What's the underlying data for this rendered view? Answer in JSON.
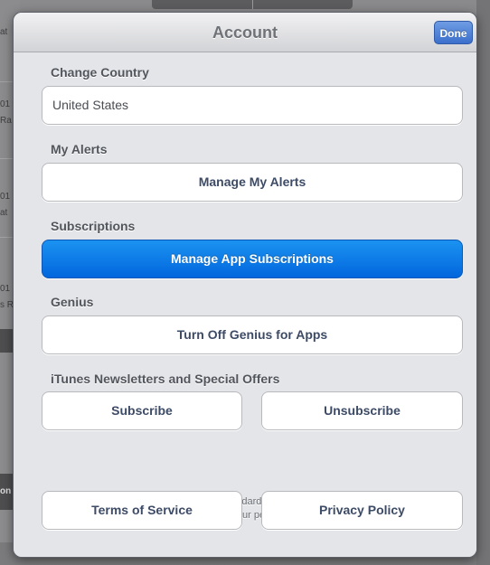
{
  "header": {
    "title": "Account",
    "done_label": "Done"
  },
  "country": {
    "section_label": "Change Country",
    "value": "United States"
  },
  "alerts": {
    "section_label": "My Alerts",
    "button_label": "Manage My Alerts"
  },
  "subscriptions": {
    "section_label": "Subscriptions",
    "button_label": "Manage App Subscriptions"
  },
  "genius": {
    "section_label": "Genius",
    "button_label": "Turn Off Genius for Apps"
  },
  "newsletters": {
    "section_label": "iTunes Newsletters and Special Offers",
    "subscribe_label": "Subscribe",
    "unsubscribe_label": "Unsubscribe"
  },
  "footer": {
    "note_line1": "Apple uses industry standard encryption to protect the",
    "note_line2": "confidentiality of your personal information.",
    "terms_label": "Terms of Service",
    "privacy_label": "Privacy Policy"
  },
  "background": {
    "fragments": [
      "at",
      "01",
      "Ra",
      "01",
      "at",
      "01",
      "s R",
      "on"
    ]
  },
  "colors": {
    "selected_button": "#0a7ae6",
    "done_button": "#4a7fd6",
    "button_text": "#3d4b66"
  }
}
